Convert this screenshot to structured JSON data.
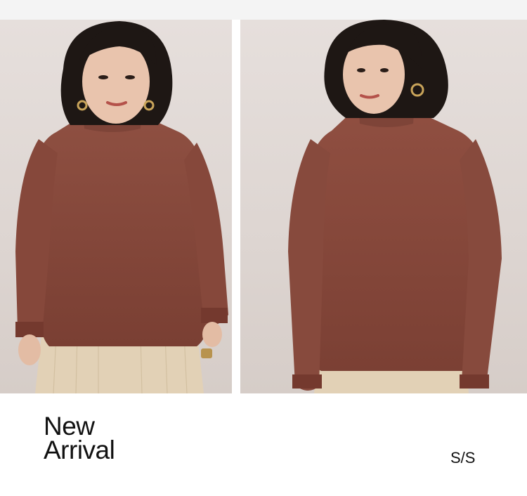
{
  "headline": {
    "line1": "New",
    "line2": "Arrival"
  },
  "season_label": "S/S",
  "colors": {
    "sweater": "#8a4a3c",
    "pants": "#e2d1b6",
    "backdrop": "#e2dad6",
    "hair": "#1e1714",
    "skin": "#e9c4ad"
  }
}
